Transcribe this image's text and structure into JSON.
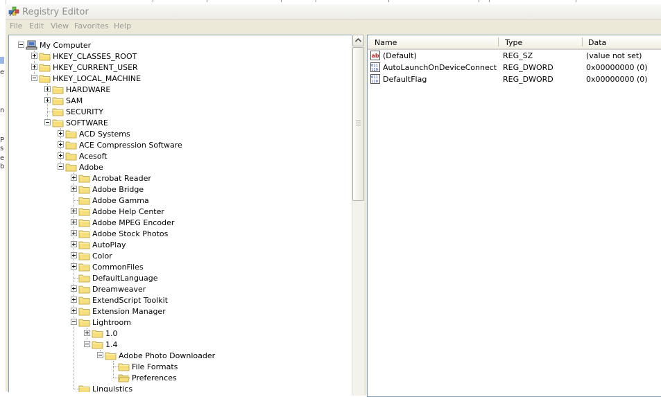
{
  "window": {
    "title": "Registry Editor"
  },
  "menu": [
    "File",
    "Edit",
    "View",
    "Favorites",
    "Help"
  ],
  "tree": {
    "nodes": [
      {
        "label": "My Computer",
        "level": 0,
        "expander": "minus",
        "icon": "computer-icon"
      },
      {
        "label": "HKEY_CLASSES_ROOT",
        "level": 1,
        "expander": "plus",
        "icon": "folder-icon"
      },
      {
        "label": "HKEY_CURRENT_USER",
        "level": 1,
        "expander": "plus",
        "icon": "folder-icon"
      },
      {
        "label": "HKEY_LOCAL_MACHINE",
        "level": 1,
        "expander": "minus",
        "icon": "folder-icon"
      },
      {
        "label": "HARDWARE",
        "level": 2,
        "expander": "plus",
        "icon": "folder-icon"
      },
      {
        "label": "SAM",
        "level": 2,
        "expander": "plus",
        "icon": "folder-icon"
      },
      {
        "label": "SECURITY",
        "level": 2,
        "expander": "none",
        "icon": "folder-icon"
      },
      {
        "label": "SOFTWARE",
        "level": 2,
        "expander": "minus",
        "icon": "folder-icon"
      },
      {
        "label": "ACD Systems",
        "level": 3,
        "expander": "plus",
        "icon": "folder-icon"
      },
      {
        "label": "ACE Compression Software",
        "level": 3,
        "expander": "plus",
        "icon": "folder-icon"
      },
      {
        "label": "Acesoft",
        "level": 3,
        "expander": "plus",
        "icon": "folder-icon"
      },
      {
        "label": "Adobe",
        "level": 3,
        "expander": "minus",
        "icon": "folder-icon"
      },
      {
        "label": "Acrobat Reader",
        "level": 4,
        "expander": "plus",
        "icon": "folder-icon"
      },
      {
        "label": "Adobe Bridge",
        "level": 4,
        "expander": "plus",
        "icon": "folder-icon"
      },
      {
        "label": "Adobe Gamma",
        "level": 4,
        "expander": "none",
        "icon": "folder-icon"
      },
      {
        "label": "Adobe Help Center",
        "level": 4,
        "expander": "plus",
        "icon": "folder-icon"
      },
      {
        "label": "Adobe MPEG Encoder",
        "level": 4,
        "expander": "plus",
        "icon": "folder-icon"
      },
      {
        "label": "Adobe Stock Photos",
        "level": 4,
        "expander": "plus",
        "icon": "folder-icon"
      },
      {
        "label": "AutoPlay",
        "level": 4,
        "expander": "plus",
        "icon": "folder-icon"
      },
      {
        "label": "Color",
        "level": 4,
        "expander": "plus",
        "icon": "folder-icon"
      },
      {
        "label": "CommonFiles",
        "level": 4,
        "expander": "plus",
        "icon": "folder-icon"
      },
      {
        "label": "DefaultLanguage",
        "level": 4,
        "expander": "none",
        "icon": "folder-icon"
      },
      {
        "label": "Dreamweaver",
        "level": 4,
        "expander": "plus",
        "icon": "folder-icon"
      },
      {
        "label": "ExtendScript Toolkit",
        "level": 4,
        "expander": "plus",
        "icon": "folder-icon"
      },
      {
        "label": "Extension Manager",
        "level": 4,
        "expander": "plus",
        "icon": "folder-icon"
      },
      {
        "label": "Lightroom",
        "level": 4,
        "expander": "minus",
        "icon": "folder-icon"
      },
      {
        "label": "1.0",
        "level": 5,
        "expander": "plus",
        "icon": "folder-icon"
      },
      {
        "label": "1.4",
        "level": 5,
        "expander": "minus",
        "icon": "folder-icon"
      },
      {
        "label": "Adobe Photo Downloader",
        "level": 6,
        "expander": "minus",
        "icon": "folder-icon"
      },
      {
        "label": "File Formats",
        "level": 7,
        "expander": "none",
        "icon": "folder-icon"
      },
      {
        "label": "Preferences",
        "level": 7,
        "expander": "none",
        "icon": "open-folder-icon",
        "selected": true
      },
      {
        "label": "Linguistics",
        "level": 4,
        "expander": "none",
        "icon": "folder-icon"
      }
    ]
  },
  "list": {
    "columns": [
      "Name",
      "Type",
      "Data"
    ],
    "rows": [
      {
        "name": "(Default)",
        "type": "REG_SZ",
        "data": "(value not set)",
        "icon": "string-value-icon"
      },
      {
        "name": "AutoLaunchOnDeviceConnect",
        "type": "REG_DWORD",
        "data": "0x00000000 (0)",
        "icon": "binary-value-icon"
      },
      {
        "name": "DefaultFlag",
        "type": "REG_DWORD",
        "data": "0x00000000 (0)",
        "icon": "binary-value-icon"
      }
    ]
  },
  "colors": {
    "folder_fill": "#f7e07b",
    "folder_stroke": "#b49a3a",
    "pane_border": "#7f9db9",
    "window_bg": "#ece9d8",
    "disabled_text": "#9a9a9a"
  }
}
